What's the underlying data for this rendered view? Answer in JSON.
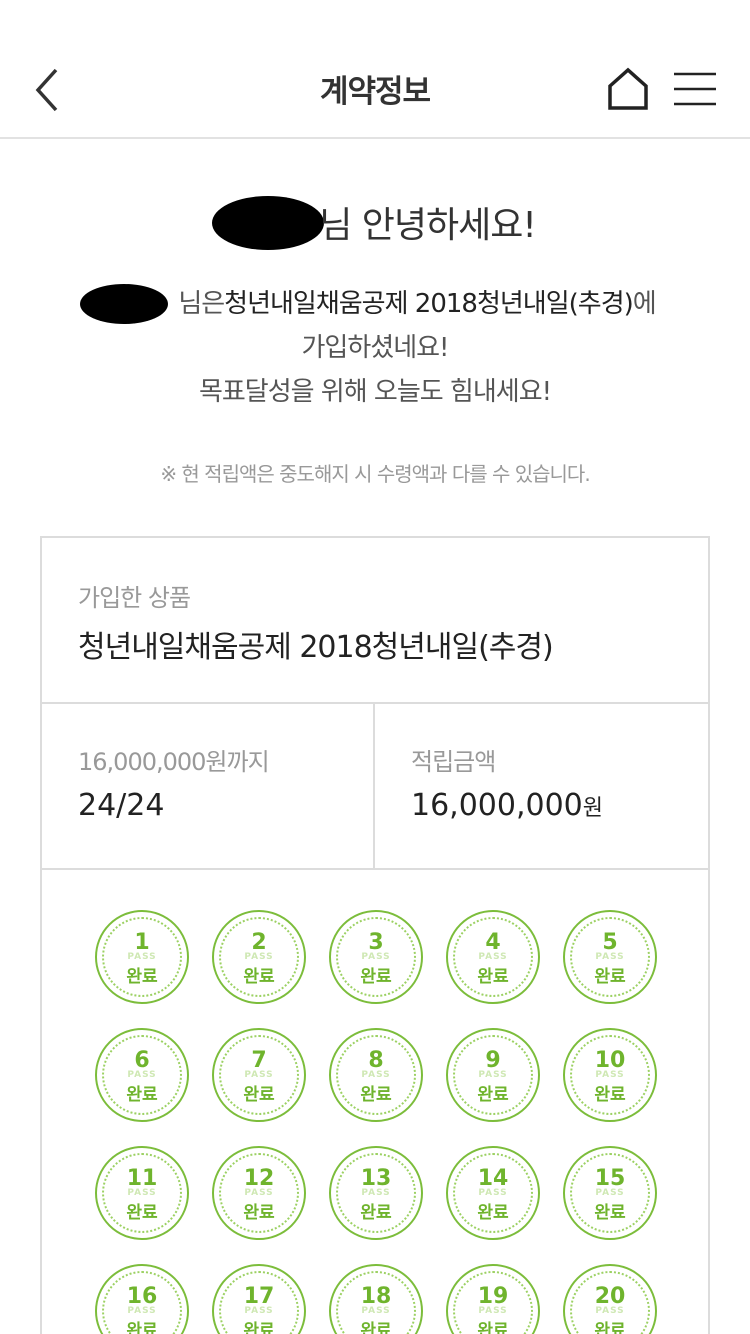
{
  "header": {
    "title": "계약정보",
    "back_icon": "chevron-left-icon",
    "home_icon": "home-icon",
    "menu_icon": "hamburger-menu-icon"
  },
  "greeting": {
    "text": "님 안녕하세요!"
  },
  "intro": {
    "line1_prefix": "님은 ",
    "line1_product": "청년내일채움공제 2018청년내일(추경)",
    "line1_suffix": "에",
    "line2": "가입하셨네요!",
    "line3": "목표달성을 위해 오늘도 힘내세요!"
  },
  "notice": "※ 현 적립액은 중도해지 시 수령액과 다를 수 있습니다.",
  "product": {
    "label": "가입한 상품",
    "name": "청년내일채움공제 2018청년내일(추경)"
  },
  "stats": {
    "target_label": "16,000,000원까지",
    "progress": "24/24",
    "saved_label": "적립금액",
    "saved_amount": "16,000,000",
    "saved_unit": "원"
  },
  "stamps": [
    {
      "num": "1",
      "status": "완료"
    },
    {
      "num": "2",
      "status": "완료"
    },
    {
      "num": "3",
      "status": "완료"
    },
    {
      "num": "4",
      "status": "완료"
    },
    {
      "num": "5",
      "status": "완료"
    },
    {
      "num": "6",
      "status": "완료"
    },
    {
      "num": "7",
      "status": "완료"
    },
    {
      "num": "8",
      "status": "완료"
    },
    {
      "num": "9",
      "status": "완료"
    },
    {
      "num": "10",
      "status": "완료"
    },
    {
      "num": "11",
      "status": "완료"
    },
    {
      "num": "12",
      "status": "완료"
    },
    {
      "num": "13",
      "status": "완료"
    },
    {
      "num": "14",
      "status": "완료"
    },
    {
      "num": "15",
      "status": "완료"
    },
    {
      "num": "16",
      "status": "완료"
    },
    {
      "num": "17",
      "status": "완료"
    },
    {
      "num": "18",
      "status": "완료"
    },
    {
      "num": "19",
      "status": "완료"
    },
    {
      "num": "20",
      "status": "완료"
    }
  ],
  "stamp_watermark": "PASS",
  "colors": {
    "stamp_green": "#6fb42d",
    "border_gray": "#dcdcdc"
  }
}
